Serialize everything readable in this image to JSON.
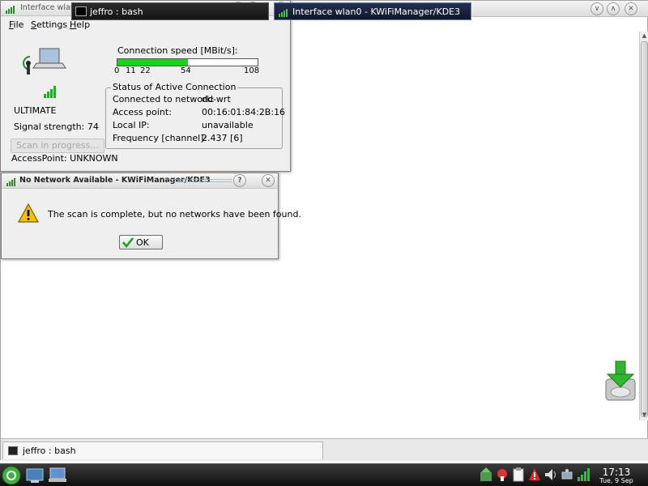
{
  "kwifi": {
    "title": "Interface wlan0 - KWiFiManager/KDE3",
    "menu": [
      "File",
      "Settings",
      "Help"
    ],
    "quality": "ULTIMATE",
    "signal_strength": "Signal strength: 74",
    "speed_label": "Connection speed [MBit/s]:",
    "speed_ticks": [
      "0",
      "11",
      "22",
      "54",
      "108"
    ],
    "speed_fill_percent": 50,
    "status_group": "Status of Active Connection",
    "status_rows": [
      {
        "label": "Connected to network:",
        "value": "dd-wrt"
      },
      {
        "label": "Access point:",
        "value": "00:16:01:84:2B:16"
      },
      {
        "label": "Local IP:",
        "value": "unavailable"
      },
      {
        "label": "Frequency [channel]:",
        "value": "2.437 [6]"
      }
    ],
    "scan_button": "Scan in progress...",
    "access_point": "AccessPoint: UNKNOWN"
  },
  "dialog": {
    "title": "No Network Available - KWiFiManager/KDE3",
    "message": "The scan is complete, but no networks have been found.",
    "ok_label": "OK"
  },
  "terminal": {
    "tab_label": "jeffro : bash"
  },
  "taskbar": {
    "task_bash": "jeffro : bash",
    "task_kwifi": "Interface wlan0 - KWiFiManager/KDE3",
    "clock_time": "17:13",
    "clock_date": "Tue, 9 Sep"
  },
  "colors": {
    "speed_fill": "#19d219",
    "warning": "#f2c200",
    "ok_check": "#1aa31a",
    "taskbar_bg": "#1a1a1a"
  }
}
